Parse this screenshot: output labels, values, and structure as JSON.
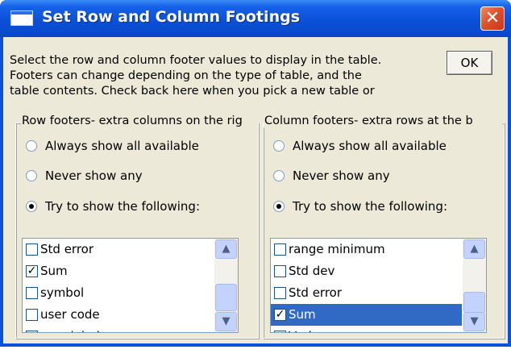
{
  "window": {
    "title": "Set Row and Column Footings",
    "close_symbol": "✕",
    "ok_label": "OK"
  },
  "description": {
    "lines": [
      "Select the row and column footer values to display in the table.",
      "Footers can change depending on the type of table, and the",
      "table contents.  Check back here when you pick a new table or"
    ]
  },
  "row_group": {
    "legend": "Row footers- extra columns on the rig",
    "options": [
      {
        "label": "Always show all available",
        "checked": false
      },
      {
        "label": "Never show any",
        "checked": false
      },
      {
        "label": "Try to show the following:",
        "checked": true
      }
    ],
    "items": [
      {
        "label": "Std error",
        "checked": false,
        "selected": false
      },
      {
        "label": "Sum",
        "checked": true,
        "selected": false
      },
      {
        "label": "symbol",
        "checked": false,
        "selected": false
      },
      {
        "label": "user code",
        "checked": false,
        "selected": false
      },
      {
        "label": "user label",
        "checked": false,
        "selected": false
      }
    ],
    "scroll_up_icon": "chevron-up-icon",
    "scroll_down_icon": "chevron-down-icon"
  },
  "column_group": {
    "legend": "Column footers-  extra rows at the b",
    "options": [
      {
        "label": "Always show all available",
        "checked": false
      },
      {
        "label": "Never show any",
        "checked": false
      },
      {
        "label": "Try to show the following:",
        "checked": true
      }
    ],
    "items": [
      {
        "label": "range minimum",
        "checked": false,
        "selected": false
      },
      {
        "label": "Std dev",
        "checked": false,
        "selected": false
      },
      {
        "label": "Std error",
        "checked": false,
        "selected": false
      },
      {
        "label": "Sum",
        "checked": true,
        "selected": true
      },
      {
        "label": "Variance",
        "checked": false,
        "selected": false
      }
    ],
    "scroll_up_icon": "chevron-up-icon",
    "scroll_down_icon": "chevron-down-icon"
  },
  "colors": {
    "titlebar": "#0a4fd6",
    "dialog_bg": "#ece9d8",
    "selection": "#316ac5",
    "close_button": "#e0502c"
  }
}
